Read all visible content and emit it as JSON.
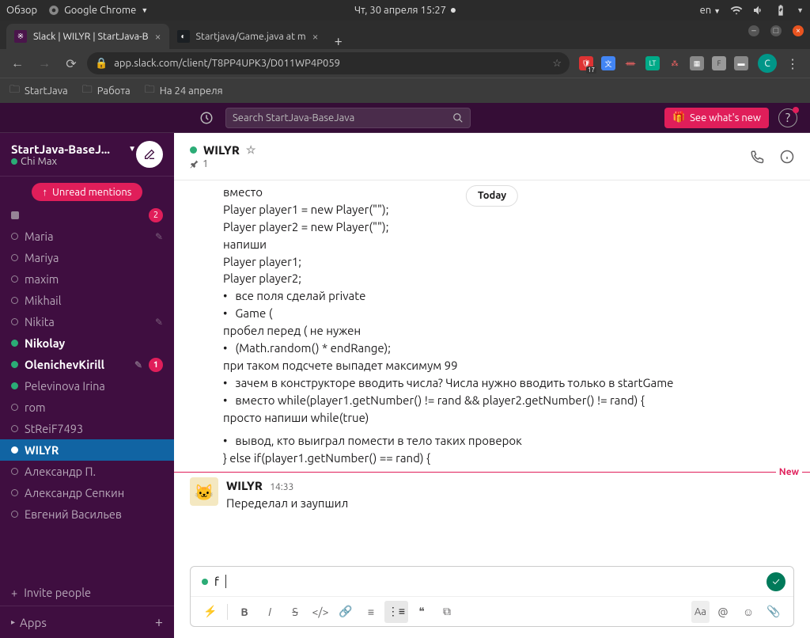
{
  "os": {
    "overview": "Обзор",
    "app_menu": "Google Chrome",
    "clock": "Чт, 30 апреля  15:27",
    "lang": "en"
  },
  "chrome": {
    "tabs": [
      {
        "title": "Slack | WILYR | StartJava-B",
        "active": true
      },
      {
        "title": "Startjava/Game.java at m",
        "active": false
      }
    ],
    "url": "app.slack.com/client/T8PP4UPK3/D011WP4P059",
    "bookmarks": [
      "StartJava",
      "Работа",
      "На 24 апреля"
    ],
    "avatar_letter": "C",
    "ext_badge": "17"
  },
  "slack": {
    "search_placeholder": "Search StartJava-BaseJava",
    "whats_new": "See what's new",
    "workspace": "StartJava-BaseJ...",
    "user": "Chi Max",
    "unread_btn": "Unread mentions",
    "dms": [
      {
        "name": "",
        "presence": "off",
        "edit": false,
        "badge": "2",
        "active": false,
        "bold": false,
        "square": true
      },
      {
        "name": "Maria",
        "presence": "off",
        "edit": true,
        "active": false
      },
      {
        "name": "Mariya",
        "presence": "off",
        "edit": false,
        "active": false
      },
      {
        "name": "maxim",
        "presence": "off",
        "edit": false,
        "active": false
      },
      {
        "name": "Mikhail",
        "presence": "off",
        "edit": false,
        "active": false
      },
      {
        "name": "Nikita",
        "presence": "off",
        "edit": true,
        "active": false
      },
      {
        "name": "Nikolay",
        "presence": "on",
        "edit": false,
        "active": false,
        "bold": true
      },
      {
        "name": "OlenichevKirill",
        "presence": "on",
        "edit": true,
        "badge": "1",
        "active": false,
        "bold": true
      },
      {
        "name": "Pelevinova Irina",
        "presence": "on",
        "edit": false,
        "active": false
      },
      {
        "name": "rom",
        "presence": "off",
        "edit": false,
        "active": false
      },
      {
        "name": "StReiF7493",
        "presence": "off",
        "edit": false,
        "active": false
      },
      {
        "name": "WILYR",
        "presence": "self",
        "edit": false,
        "active": true,
        "bold": true
      },
      {
        "name": "Александр П.",
        "presence": "off",
        "edit": false,
        "active": false
      },
      {
        "name": "Александр Сепкин",
        "presence": "off",
        "edit": false,
        "active": false
      },
      {
        "name": "Евгений Васильев",
        "presence": "off",
        "edit": false,
        "active": false
      }
    ],
    "invite": "Invite people",
    "apps": "Apps"
  },
  "channel": {
    "name": "WILYR",
    "pin_count": "1",
    "today": "Today",
    "new_label": "New",
    "lines": [
      "вместо",
      "Player player1 = new Player(\"\");",
      "        Player player2 = new Player(\"\");",
      "напиши",
      "Player player1;",
      "Player player2;"
    ],
    "bul1": "все поля сделай private",
    "bul2": "Game (",
    "line_a": "пробел перед ( не нужен",
    "bul3": "(Math.random() * endRange);",
    "line_b": "при таком подсчете выпадет максимум 99",
    "bul4": "зачем в конструкторе вводить числа? Числа нужно вводить только в startGame",
    "bul5": "вместо while(player1.getNumber() != rand && player2.getNumber() != rand) {",
    "line_c": "просто напиши while(true)",
    "bul6": "вывод, кто выиграл помести в тело таких проверок",
    "line_d": "} else if(player1.getNumber() == rand) {",
    "msg2": {
      "author": "WILYR",
      "time": "14:33",
      "text": "Переделал и заупшил"
    },
    "composer_text": "f",
    "aa": "Aa"
  }
}
